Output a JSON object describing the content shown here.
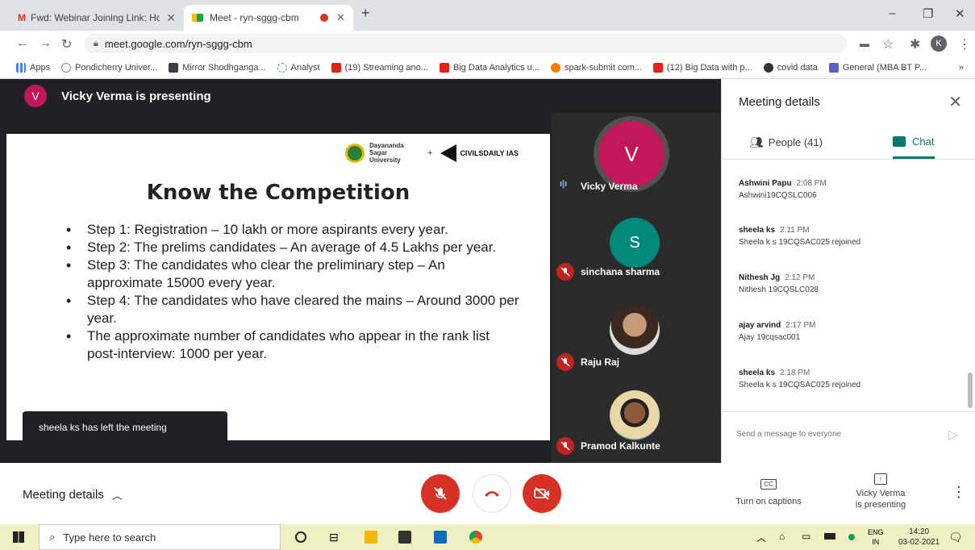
{
  "browser": {
    "tabs": [
      {
        "title": "Fwd: Webinar Joining Link: How t",
        "icon": "gmail-icon"
      },
      {
        "title": "Meet - ryn-sggg-cbm",
        "icon": "meet-icon"
      }
    ],
    "url": "meet.google.com/ryn-sggg-cbm",
    "profile_initial": "K",
    "bookmarks": [
      {
        "label": "Apps",
        "icon": "apps-icon"
      },
      {
        "label": "Pondicherry Univer...",
        "icon": "globe-icon"
      },
      {
        "label": "Mirror Shodhganga...",
        "icon": "d-icon"
      },
      {
        "label": "Analyst",
        "icon": "star-icon"
      },
      {
        "label": "(19) Streaming ano...",
        "icon": "youtube-icon"
      },
      {
        "label": "Big Data Analytics u...",
        "icon": "youtube-icon"
      },
      {
        "label": "spark-submit com...",
        "icon": "orange-icon"
      },
      {
        "label": "(12) Big Data with p...",
        "icon": "youtube-icon"
      },
      {
        "label": "covid data",
        "icon": "github-icon"
      },
      {
        "label": "General (MBA BT P...",
        "icon": "teams-icon"
      }
    ]
  },
  "meet": {
    "presenter_initial": "V",
    "presenting_text": "Vicky Verma is presenting",
    "slide": {
      "logo_left": "Dayananda Sagar University",
      "logo_plus": "+",
      "logo_right": "CIVILSDAILY IAS",
      "title": "Know the Competition",
      "items": [
        "Step 1: Registration –  10 lakh or more aspirants every year.",
        "Step 2: The prelims candidates –  An average of 4.5 Lakhs per year.",
        "Step 3: The candidates who clear the preliminary step – An approximate 15000 every year.",
        "Step 4: The candidates who have cleared the mains – Around 3000 per year.",
        "The approximate number of candidates who appear in the rank list post-interview: 1000 per year."
      ]
    },
    "toast": "sheela ks has left the meeting",
    "participants": [
      {
        "name": "Vicky Verma",
        "initial": "V",
        "color": "#c2185b",
        "speaking": true
      },
      {
        "name": "sinchana sharma",
        "initial": "S",
        "color": "#00897b",
        "muted": true
      },
      {
        "name": "Raju Raj",
        "initial": "",
        "muted": true
      },
      {
        "name": "Pramod Kalkunte",
        "initial": "",
        "muted": true
      }
    ]
  },
  "panel": {
    "title": "Meeting details",
    "people_tab": "People (41)",
    "chat_tab": "Chat",
    "messages": [
      {
        "author": "Ashwini Papu",
        "time": "2:08 PM",
        "text": "Ashwini19CQSLC006"
      },
      {
        "author": "sheela ks",
        "time": "2:11 PM",
        "text": "Sheela k s 19CQSAC025 rejoined"
      },
      {
        "author": "Nithesh Jg",
        "time": "2:12 PM",
        "text": "Nithesh 19CQSLC028"
      },
      {
        "author": "ajay arvind",
        "time": "2:17 PM",
        "text": "Ajay 19cqsac001"
      },
      {
        "author": "sheela ks",
        "time": "2:18 PM",
        "text": "Sheela k s 19CQSAC025 rejoined"
      }
    ],
    "send_placeholder": "Send a message to everyone"
  },
  "controls": {
    "meeting_details": "Meeting details",
    "captions_label": "Turn on captions",
    "presenting_label_1": "Vicky Verma",
    "presenting_label_2": "is presenting"
  },
  "taskbar": {
    "search_placeholder": "Type here to search",
    "lang_1": "ENG",
    "lang_2": "IN",
    "time": "14:20",
    "date": "03-02-2021"
  },
  "colors": {
    "accent": "#00796b",
    "red": "#d93025",
    "meet_bg": "#202124"
  }
}
